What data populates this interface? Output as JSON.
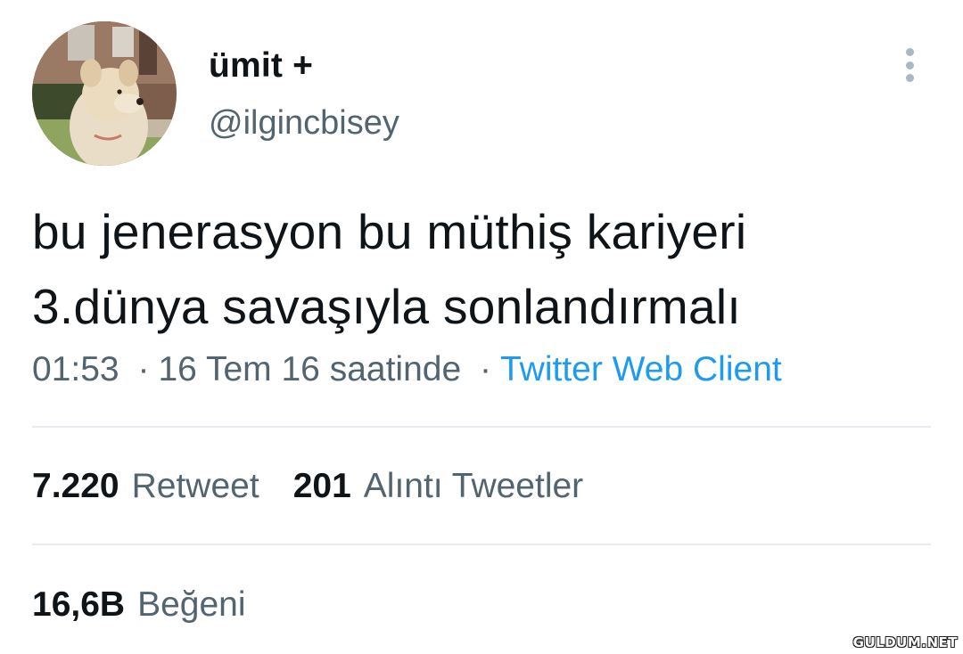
{
  "author": {
    "display_name": "ümit +",
    "handle": "@ilgincbisey",
    "avatar": "dog-profile-photo"
  },
  "tweet": {
    "text_lines": [
      "bu jenerasyon bu müthiş kariyeri",
      "3.dünya savaşıyla sonlandırmalı"
    ],
    "time": "01:53",
    "date": "16 Tem 16 saatinde",
    "separator": "·",
    "source": "Twitter Web Client"
  },
  "stats": {
    "retweets": {
      "count": "7.220",
      "label": "Retweet"
    },
    "quotes": {
      "count": "201",
      "label": "Alıntı Tweetler"
    },
    "likes": {
      "count": "16,6B",
      "label": "Beğeni"
    }
  },
  "icons": {
    "more": "more-vertical-icon"
  },
  "watermark": "GULDUM.NET",
  "colors": {
    "text_primary": "#0f1419",
    "text_secondary": "#536471",
    "link": "#1d9bf0",
    "divider": "#e6ecf0"
  }
}
